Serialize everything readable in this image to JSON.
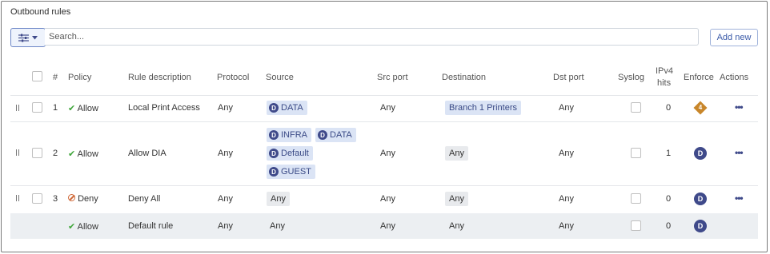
{
  "panel": {
    "title": "Outbound rules"
  },
  "toolbar": {
    "search_placeholder": "Search...",
    "add_label": "Add new"
  },
  "columns": {
    "num": "#",
    "policy": "Policy",
    "description": "Rule description",
    "protocol": "Protocol",
    "source": "Source",
    "src_port": "Src port",
    "destination": "Destination",
    "dst_port": "Dst port",
    "syslog": "Syslog",
    "ipv4_line1": "IPv4",
    "ipv4_line2": "hits",
    "enforce": "Enforce",
    "actions": "Actions"
  },
  "rows": [
    {
      "num": "1",
      "policy": "Allow",
      "description": "Local Print Access",
      "protocol": "Any",
      "source": [
        {
          "badge": "D",
          "label": "DATA"
        }
      ],
      "src_port": "Any",
      "destination": "Branch 1 Printers",
      "dst_port": "Any",
      "hits": "0",
      "enforce": "4",
      "actions": "•••"
    },
    {
      "num": "2",
      "policy": "Allow",
      "description": "Allow DIA",
      "protocol": "Any",
      "source": [
        {
          "badge": "D",
          "label": "INFRA"
        },
        {
          "badge": "D",
          "label": "DATA"
        },
        {
          "badge": "D",
          "label": "Default"
        },
        {
          "badge": "D",
          "label": "GUEST"
        }
      ],
      "src_port": "Any",
      "destination": "Any",
      "dst_port": "Any",
      "hits": "1",
      "enforce": "D",
      "actions": "•••"
    },
    {
      "num": "3",
      "policy": "Deny",
      "description": "Deny All",
      "protocol": "Any",
      "source_text": "Any",
      "src_port": "Any",
      "destination": "Any",
      "dst_port": "Any",
      "hits": "0",
      "enforce": "D",
      "actions": "•••"
    },
    {
      "policy": "Allow",
      "description": "Default rule",
      "protocol": "Any",
      "source_text": "Any",
      "src_port": "Any",
      "destination": "Any",
      "dst_port": "Any",
      "hits": "0",
      "enforce": "D"
    }
  ],
  "glyphs": {
    "check": "✔"
  },
  "icons": {
    "filter": "sliders-icon",
    "caret": "caret-down-icon",
    "drag": "drag-handle-icon",
    "deny": "no-entry-icon"
  },
  "colors": {
    "accent": "#3f4a8a",
    "allow": "#3fa53a",
    "deny": "#d06a3a",
    "enforce_warning": "#c8862a"
  }
}
